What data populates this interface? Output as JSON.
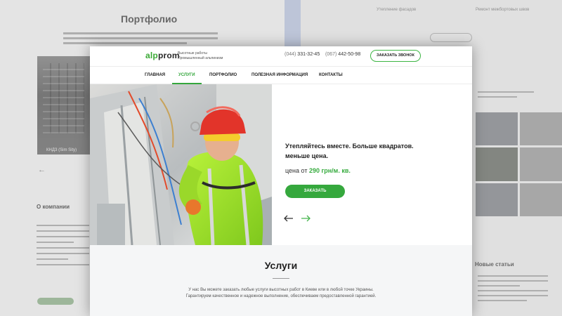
{
  "background": {
    "portfolio_title": "Портфолио",
    "building_caption": "КНДЗ (Sim Sity)",
    "about_title": "О компании",
    "right_top_1": "Утепление фасадов",
    "right_top_2": "Ремонт межбортовых швов",
    "news_title": "Новые статьи"
  },
  "header": {
    "logo_prefix": "alp",
    "logo_suffix": "prom",
    "tagline_line1": "Высотные работы",
    "tagline_line2": "Промышленный альпинизм",
    "phone1_prefix": "(044)",
    "phone1_number": "331-32-45",
    "phone2_prefix": "(067)",
    "phone2_number": "442-50-98",
    "callback_label": "ЗАКАЗАТЬ ЗВОНОК"
  },
  "nav": {
    "items": [
      {
        "label": "ГЛАВНАЯ"
      },
      {
        "label": "УСЛУГИ"
      },
      {
        "label": "ПОРТФОЛИО"
      },
      {
        "label": "ПОЛЕЗНАЯ ИНФОРМАЦИЯ"
      },
      {
        "label": "КОНТАКТЫ"
      }
    ],
    "active": "УСЛУГИ"
  },
  "hero": {
    "headline_line1": "Утепляйтесь вместе. Больше квадратов.",
    "headline_line2": "меньше цена.",
    "price_prefix": "цена от",
    "price_value": "290 грн/м. кв.",
    "order_label": "ЗАКАЗАТЬ",
    "photo_subject": "industrial climber in red helmet and hi-vis jacket"
  },
  "services": {
    "title": "Услуги",
    "text_line1": "У нас Вы можете заказать любые услуги высотных работ в Киеве или в любой точке Украины.",
    "text_line2": "Гарантируем качественное и надежное выполнение, обеспечиваем предоставленной гарантией."
  },
  "colors": {
    "accent_green": "#35a83d",
    "text_dark": "#1f1f1f"
  }
}
